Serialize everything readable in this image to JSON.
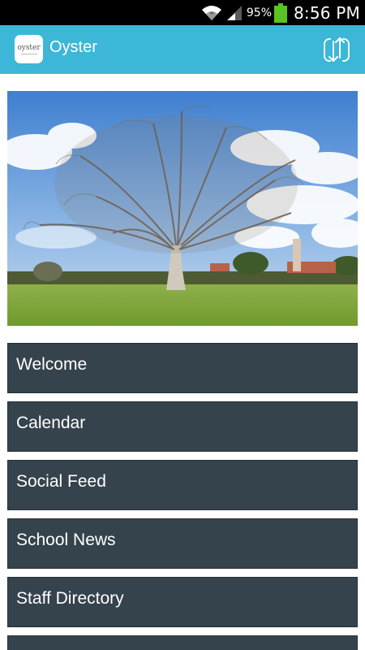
{
  "status_bar": {
    "battery_percent": "95%",
    "time": "8:56 PM",
    "icons": [
      "wifi-icon",
      "signal-icon",
      "battery-icon"
    ]
  },
  "app_bar": {
    "logo_text": "oyster",
    "title": "Oyster",
    "sync_icon": "sync-arrows-icon",
    "color": "#3db7d7"
  },
  "hero_image": {
    "subject": "tree-in-field-photo"
  },
  "menu": {
    "item_color": "#35434c",
    "items": [
      {
        "label": "Welcome"
      },
      {
        "label": "Calendar"
      },
      {
        "label": "Social Feed"
      },
      {
        "label": "School News"
      },
      {
        "label": "Staff Directory"
      },
      {
        "label": ""
      }
    ]
  }
}
